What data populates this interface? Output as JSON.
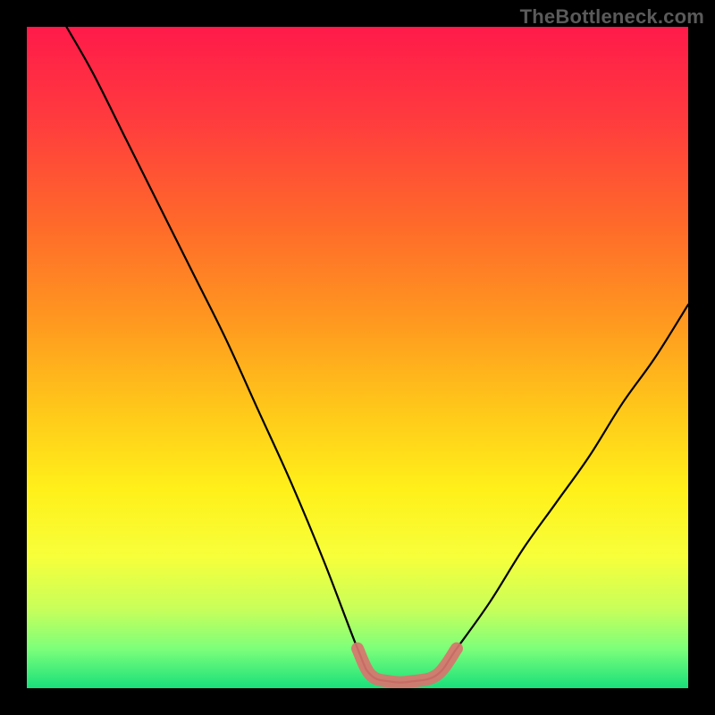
{
  "watermark": "TheBottleneck.com",
  "colors": {
    "frame": "#000000",
    "gradient_stops": [
      {
        "offset": 0.0,
        "color": "#ff1a4a"
      },
      {
        "offset": 0.14,
        "color": "#ff3b3e"
      },
      {
        "offset": 0.3,
        "color": "#ff6a2a"
      },
      {
        "offset": 0.45,
        "color": "#ff9a1f"
      },
      {
        "offset": 0.58,
        "color": "#ffc81a"
      },
      {
        "offset": 0.7,
        "color": "#fff01a"
      },
      {
        "offset": 0.8,
        "color": "#f7ff3a"
      },
      {
        "offset": 0.88,
        "color": "#c8ff5a"
      },
      {
        "offset": 0.94,
        "color": "#7dff7a"
      },
      {
        "offset": 1.0,
        "color": "#18e07a"
      }
    ],
    "curve": "#000000",
    "highlight": "#d9746e"
  },
  "chart_data": {
    "type": "line",
    "title": "",
    "xlabel": "",
    "ylabel": "",
    "xlim": [
      0,
      1
    ],
    "ylim": [
      0,
      1
    ],
    "series": [
      {
        "name": "bottleneck-curve",
        "x": [
          0.06,
          0.1,
          0.15,
          0.2,
          0.25,
          0.3,
          0.35,
          0.4,
          0.45,
          0.5,
          0.52,
          0.55,
          0.58,
          0.62,
          0.65,
          0.7,
          0.75,
          0.8,
          0.85,
          0.9,
          0.95,
          1.0
        ],
        "y": [
          1.0,
          0.93,
          0.83,
          0.73,
          0.63,
          0.53,
          0.42,
          0.31,
          0.19,
          0.06,
          0.02,
          0.01,
          0.01,
          0.02,
          0.06,
          0.13,
          0.21,
          0.28,
          0.35,
          0.43,
          0.5,
          0.58
        ]
      },
      {
        "name": "valley-highlight",
        "x": [
          0.5,
          0.52,
          0.55,
          0.58,
          0.62,
          0.65
        ],
        "y": [
          0.06,
          0.02,
          0.01,
          0.01,
          0.02,
          0.06
        ]
      }
    ]
  }
}
